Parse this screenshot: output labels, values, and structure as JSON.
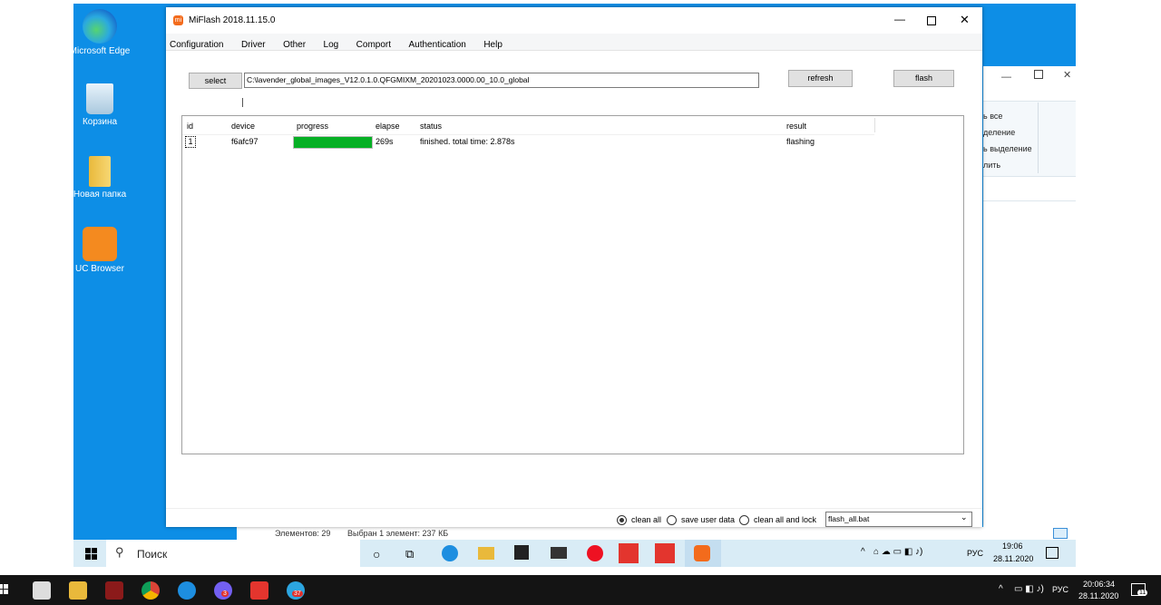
{
  "desktop": {
    "icons": [
      {
        "label": "Microsoft Edge",
        "icon": "edge-icon"
      },
      {
        "label": "Корзина",
        "icon": "recycle-bin-icon"
      },
      {
        "label": "Новая папка",
        "icon": "folder-icon"
      },
      {
        "label": "UC Browser",
        "icon": "uc-browser-icon"
      }
    ]
  },
  "explorer_bg": {
    "items": [
      "ь все",
      "деление",
      "ь выделение",
      "лить"
    ],
    "status": {
      "count": "Элементов: 29",
      "selected": "Выбран 1 элемент: 237 КБ"
    }
  },
  "miflash": {
    "title": "MiFlash 2018.11.15.0",
    "menu": [
      "Configuration",
      "Driver",
      "Other",
      "Log",
      "Comport",
      "Authentication",
      "Help"
    ],
    "select_label": "select",
    "path_value": "C:\\lavender_global_images_V12.0.1.0.QFGMIXM_20201023.0000.00_10.0_global",
    "refresh_label": "refresh",
    "flash_label": "flash",
    "table": {
      "headers": {
        "id": "id",
        "device": "device",
        "progress": "progress",
        "elapse": "elapse",
        "status": "status",
        "result": "result"
      },
      "rows": [
        {
          "id": "1",
          "device": "f6afc97",
          "progress": 1.0,
          "elapse": "269s",
          "status": "finished. total time: 2.878s",
          "result": "flashing"
        }
      ]
    },
    "options": {
      "clean_all": "clean all",
      "save_user_data": "save user data",
      "clean_all_lock": "clean all and lock",
      "selected": "clean_all",
      "script": "flash_all.bat"
    },
    "progress_color": "#06b025"
  },
  "inner_taskbar": {
    "search_placeholder": "Поиск",
    "lang": "РУС",
    "time": "19:06",
    "date": "28.11.2020"
  },
  "outer_taskbar": {
    "lang": "РУС",
    "time": "20:06:34",
    "date": "28.11.2020",
    "badges": {
      "viber": "3",
      "telegram": "37"
    },
    "notif_count": "11"
  }
}
